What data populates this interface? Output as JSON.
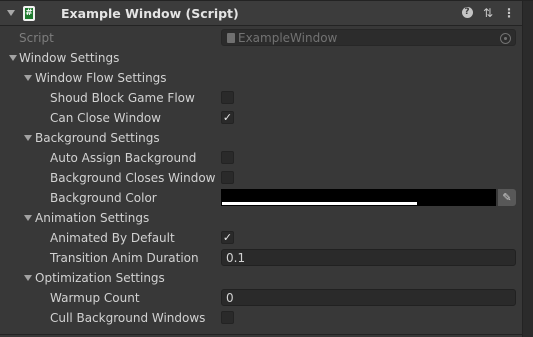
{
  "header": {
    "title": "Example Window (Script)",
    "script_icon_glyph": "#",
    "help_glyph": "?",
    "preset_glyph": "⇅",
    "more_glyph": "⋮"
  },
  "script_row": {
    "label": "Script",
    "value": "ExampleWindow"
  },
  "window_settings": {
    "label": "Window Settings",
    "flow": {
      "label": "Window Flow Settings",
      "should_block": {
        "label": "Shoud Block Game Flow",
        "checked": false
      },
      "can_close": {
        "label": "Can Close Window",
        "checked": true
      }
    },
    "background": {
      "label": "Background Settings",
      "auto_assign": {
        "label": "Auto Assign Background",
        "checked": false
      },
      "closes_window": {
        "label": "Background Closes Window",
        "checked": false
      },
      "color": {
        "label": "Background Color",
        "value": "#000000",
        "alpha": 1.0
      }
    },
    "animation": {
      "label": "Animation Settings",
      "animated_default": {
        "label": "Animated By Default",
        "checked": true
      },
      "duration": {
        "label": "Transition Anim Duration",
        "value": "0.1"
      }
    },
    "optimization": {
      "label": "Optimization Settings",
      "warmup": {
        "label": "Warmup Count",
        "value": "0"
      },
      "cull": {
        "label": "Cull Background Windows",
        "checked": false
      }
    }
  },
  "check_glyph": "✓",
  "eyedropper_glyph": "✎",
  "colors": {
    "background": "#383838",
    "field": "#2a2a2a",
    "text": "#d2d2d2"
  }
}
